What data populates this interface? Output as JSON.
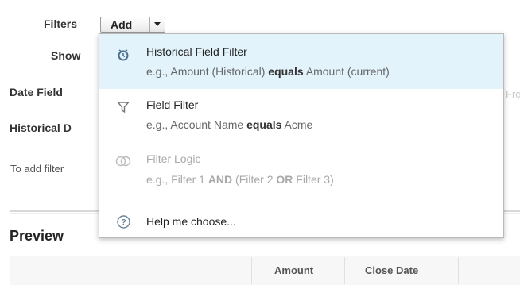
{
  "labels": {
    "filters": "Filters",
    "show": "Show",
    "date_field": "Date Field",
    "historical_date": "Historical D",
    "add_note": "To add filter",
    "faded_right": "Fro",
    "preview": "Preview"
  },
  "add_button": {
    "label": "Add"
  },
  "menu": {
    "items": [
      {
        "title": "Historical Field Filter",
        "sub_pre": "e.g., Amount (Historical) ",
        "sub_bold": "equals",
        "sub_post": " Amount (current)",
        "icon": "history-filter-icon"
      },
      {
        "title": "Field Filter",
        "sub_pre": "e.g., Account Name ",
        "sub_bold": "equals",
        "sub_post": " Acme",
        "icon": "funnel-icon"
      },
      {
        "title": "Filter Logic",
        "sub_a": "e.g., Filter 1 ",
        "sub_b": "AND",
        "sub_c": " (Filter 2 ",
        "sub_d": "OR",
        "sub_e": " Filter 3)",
        "icon": "venn-icon"
      }
    ],
    "help": {
      "title": "Help me choose...",
      "icon": "help-icon"
    }
  },
  "preview_columns": [
    "Amount",
    "Close Date"
  ],
  "colors": {
    "highlight": "#e2f3fb",
    "accent": "#3b7fb5"
  }
}
